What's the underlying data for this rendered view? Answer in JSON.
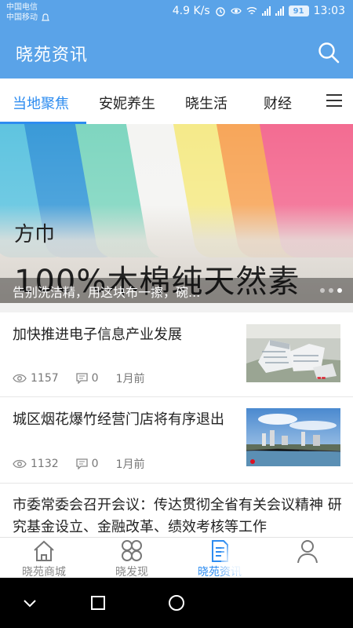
{
  "status_bar": {
    "carrier_1": "中国电信",
    "carrier_2": "中国移动",
    "speed": "4.9 K/s",
    "battery": "91",
    "time": "13:03"
  },
  "header": {
    "title": "晓苑资讯",
    "search_icon": "search-icon"
  },
  "tabs": [
    {
      "label": "当地聚焦",
      "active": true
    },
    {
      "label": "安妮养生",
      "active": false
    },
    {
      "label": "晓生活",
      "active": false
    },
    {
      "label": "财经",
      "active": false
    }
  ],
  "banner": {
    "small_text": "方巾",
    "big_text": "100%木棉纯天然素",
    "caption": "告别洗洁精，用这块布一擦，碗...",
    "slide_count": 3,
    "active_slide": 2
  },
  "news": [
    {
      "title": "加快推进电子信息产业发展",
      "views": "1157",
      "comments": "0",
      "time": "1月前"
    },
    {
      "title": "城区烟花爆竹经营门店将有序退出",
      "views": "1132",
      "comments": "0",
      "time": "1月前"
    },
    {
      "title": "市委常委会召开会议：传达贯彻全省有关会议精神 研究基金设立、金融改革、绩效考核等工作"
    }
  ],
  "bottom_nav": [
    {
      "label": "晓苑商城",
      "icon": "home-icon",
      "active": false
    },
    {
      "label": "晓发现",
      "icon": "discover-icon",
      "active": false
    },
    {
      "label": "晓苑资讯",
      "icon": "news-icon",
      "active": true
    },
    {
      "label": "",
      "icon": "profile-icon",
      "active": false
    }
  ],
  "colors": {
    "primary": "#5aa3e8",
    "accent": "#2d8cf0"
  }
}
